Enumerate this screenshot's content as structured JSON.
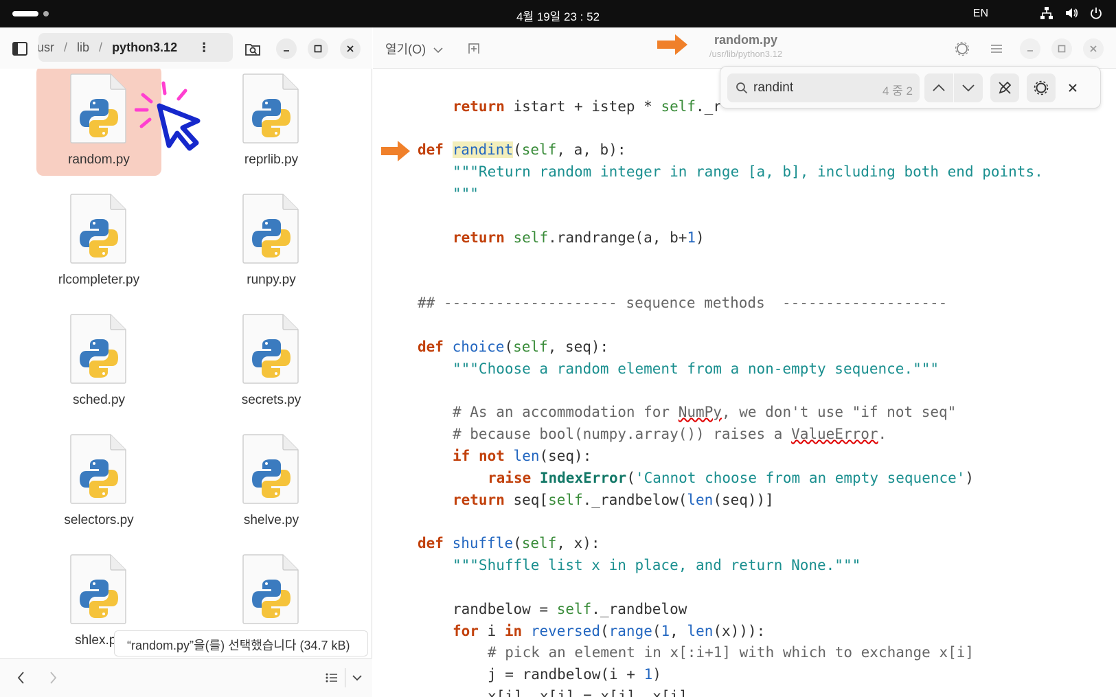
{
  "system_bar": {
    "clock": "4월 19일  23 : 52",
    "lang": "EN"
  },
  "files": {
    "path": {
      "seg1": "usr",
      "seg2": "lib",
      "current": "python3.12"
    },
    "items": [
      {
        "name": "random.py",
        "selected": true
      },
      {
        "name": "reprlib.py"
      },
      {
        "name": "rlcompleter.py"
      },
      {
        "name": "runpy.py"
      },
      {
        "name": "sched.py"
      },
      {
        "name": "secrets.py"
      },
      {
        "name": "selectors.py"
      },
      {
        "name": "shelve.py"
      },
      {
        "name": "shlex.py"
      },
      {
        "name": ""
      }
    ],
    "status_tooltip": "“random.py”을(를) 선택했습니다 (34.7 kB)",
    "colors": {
      "selection": "#f8cfc2",
      "python_blue": "#3b7bbf",
      "python_yellow": "#f5c33b"
    }
  },
  "editor": {
    "open_button": "열기(O)",
    "title": "random.py",
    "subtitle": "/usr/lib/python3.12",
    "search": {
      "value": "randint",
      "match_count": "4 중 2"
    },
    "colors": {
      "keyword": "#c2410c",
      "function": "#2266c0",
      "self": "#3a8c3a",
      "string": "#1a8f8f",
      "arrow": "#f0802a"
    }
  }
}
